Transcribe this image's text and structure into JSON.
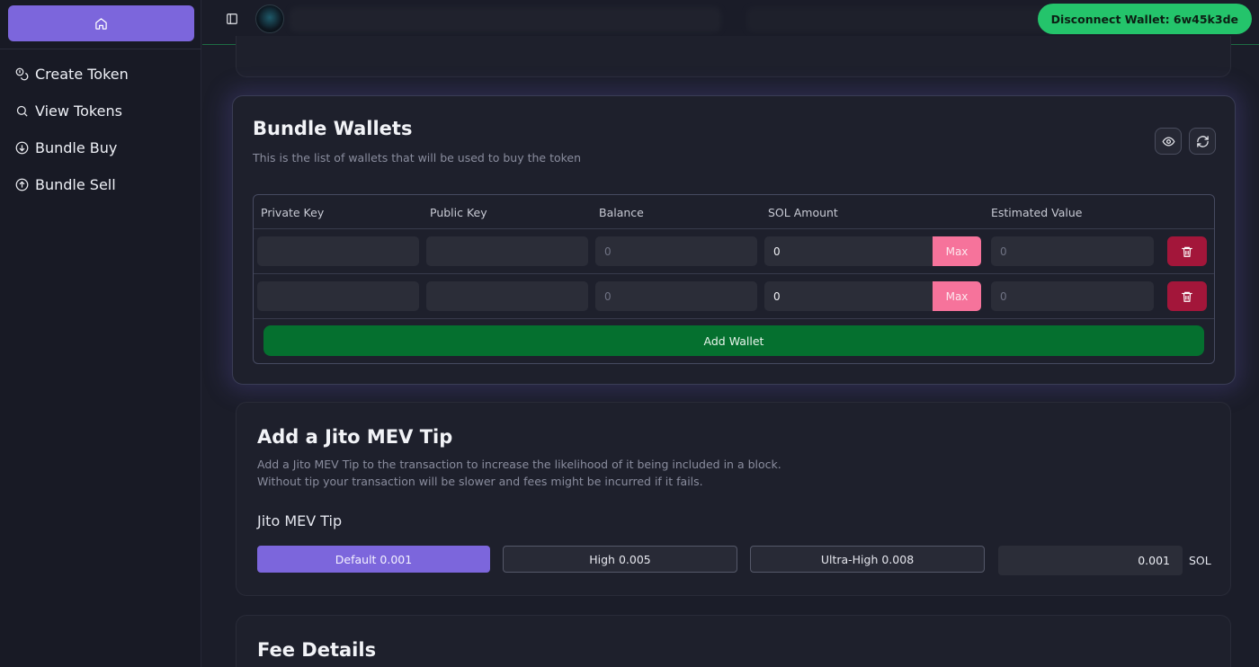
{
  "sidebar": {
    "home_icon": "home-icon",
    "items": [
      {
        "label": "Create Token",
        "icon": "coins-icon"
      },
      {
        "label": "View Tokens",
        "icon": "search-icon"
      },
      {
        "label": "Bundle Buy",
        "icon": "arrow-down-circle-icon"
      },
      {
        "label": "Bundle Sell",
        "icon": "arrow-up-circle-icon"
      }
    ]
  },
  "topbar": {
    "disconnect_label": "Disconnect Wallet: 6w45k3de",
    "accent_color": "#24c46b"
  },
  "bundle": {
    "title": "Bundle Wallets",
    "description": "This is the list of wallets that will be used to buy the token",
    "columns": [
      "Private Key",
      "Public Key",
      "Balance",
      "SOL Amount",
      "Estimated Value"
    ],
    "rows": [
      {
        "private_key": "",
        "public_key": "",
        "balance": "0",
        "sol_amount": "0",
        "max_label": "Max",
        "estimated_value": "0"
      },
      {
        "private_key": "",
        "public_key": "",
        "balance": "0",
        "sol_amount": "0",
        "max_label": "Max",
        "estimated_value": "0"
      }
    ],
    "add_wallet_label": "Add Wallet"
  },
  "jito": {
    "title": "Add a Jito MEV Tip",
    "description_line1": "Add a Jito MEV Tip to the transaction to increase the likelihood of it being included in a block.",
    "description_line2": "Without tip your transaction will be slower and fees might be incurred if it fails.",
    "tip_label": "Jito MEV Tip",
    "options": [
      "Default 0.001",
      "High 0.005",
      "Ultra-High 0.008"
    ],
    "selected_option": "Default 0.001",
    "tip_value": "0.001",
    "unit": "SOL"
  },
  "fee": {
    "title": "Fee Details"
  },
  "colors": {
    "primary": "#7c66dc",
    "max_button": "#f6739b",
    "delete_button": "#a3163a",
    "add_wallet": "#05702f"
  }
}
